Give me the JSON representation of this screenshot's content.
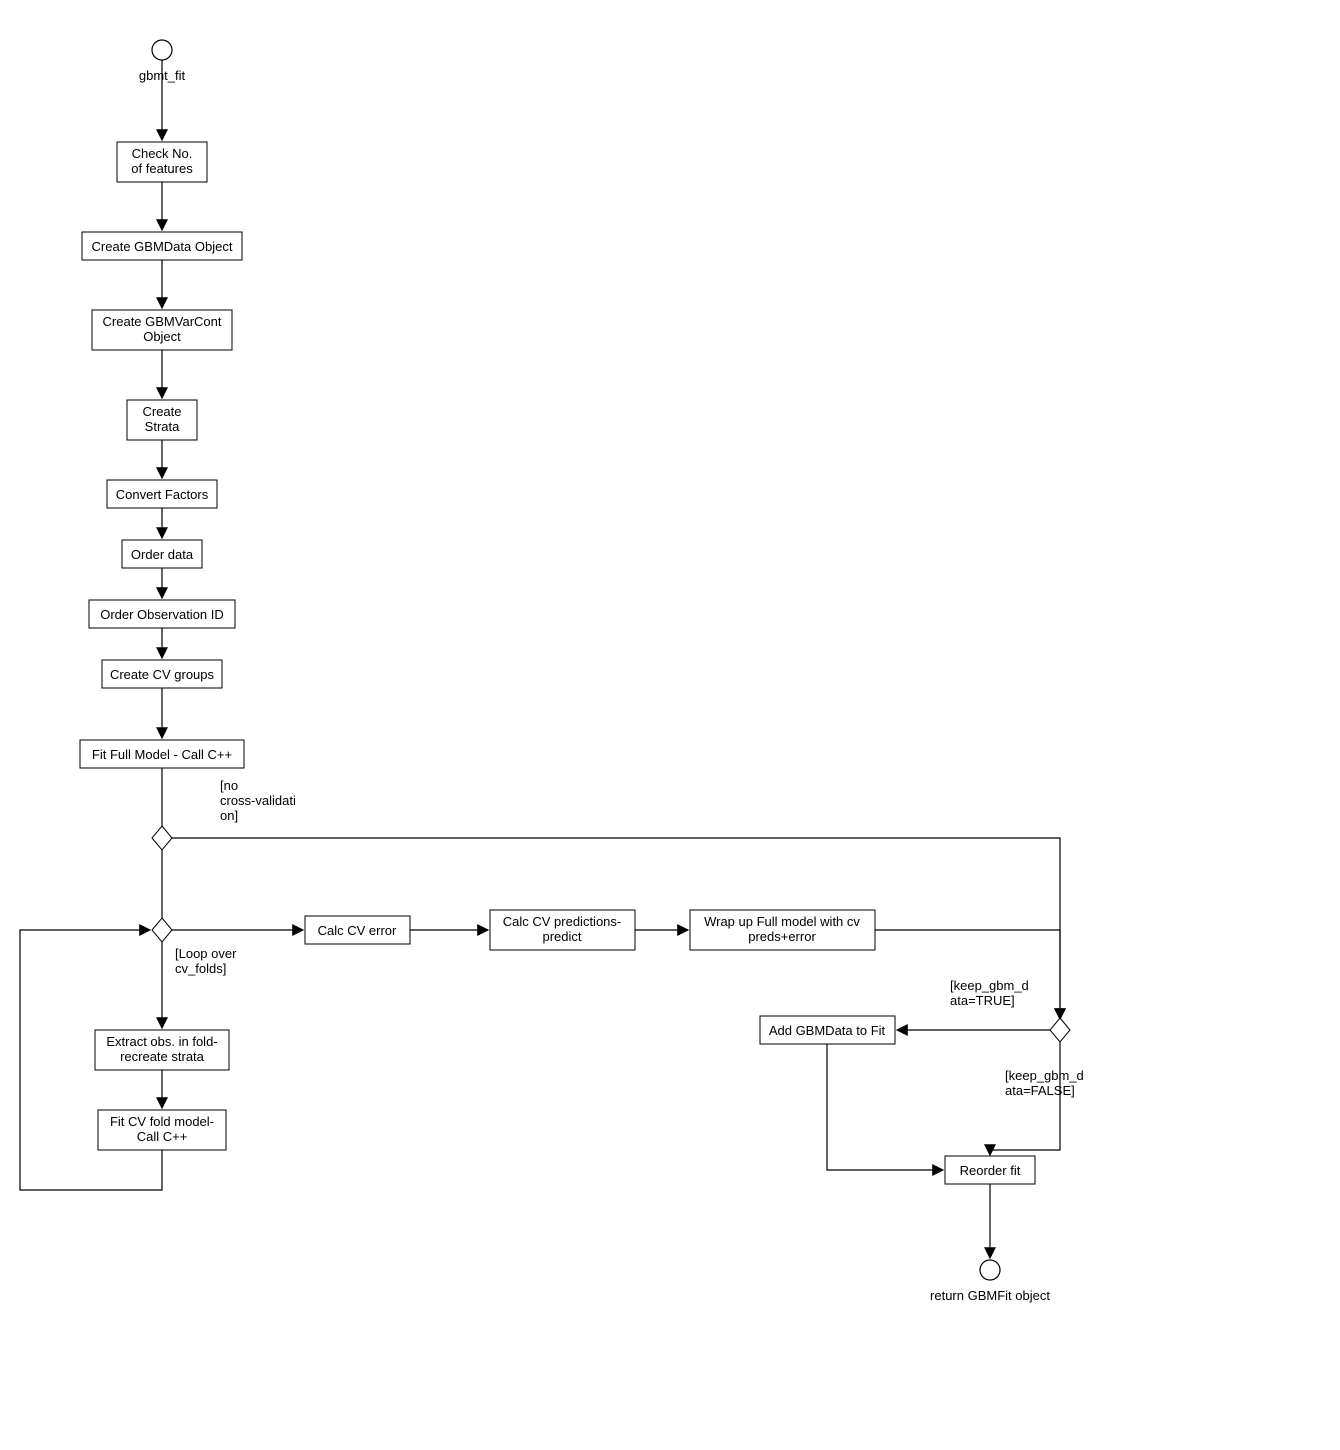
{
  "diagram": {
    "type": "activity-flowchart",
    "start_label": "gbmt_fit",
    "end_label": "return GBMFit object",
    "boxes": {
      "check_features_1": "Check No.",
      "check_features_2": "of features",
      "create_gbmdata": "Create GBMData Object",
      "create_varcont_1": "Create GBMVarCont",
      "create_varcont_2": "Object",
      "create_strata_1": "Create",
      "create_strata_2": "Strata",
      "convert_factors": "Convert Factors",
      "order_data": "Order data",
      "order_obs_id": "Order Observation ID",
      "create_cv_groups": "Create CV groups",
      "fit_full_model": "Fit Full Model - Call C++",
      "calc_cv_error": "Calc CV error",
      "calc_cv_pred_1": "Calc CV predictions-",
      "calc_cv_pred_2": "predict",
      "wrap_up_1": "Wrap up Full model with cv",
      "wrap_up_2": "preds+error",
      "add_gbmdata": "Add GBMData to Fit",
      "extract_obs_1": "Extract obs. in fold-",
      "extract_obs_2": "recreate strata",
      "fit_cv_fold_1": "Fit CV fold model-",
      "fit_cv_fold_2": "Call C++",
      "reorder_fit": "Reorder fit"
    },
    "branch_labels": {
      "no_cv_1": "[no",
      "no_cv_2": "cross-validati",
      "no_cv_3": "on]",
      "loop_1": "[Loop over",
      "loop_2": "cv_folds]",
      "keep_true_1": "[keep_gbm_d",
      "keep_true_2": "ata=TRUE]",
      "keep_false_1": "[keep_gbm_d",
      "keep_false_2": "ata=FALSE]"
    }
  }
}
